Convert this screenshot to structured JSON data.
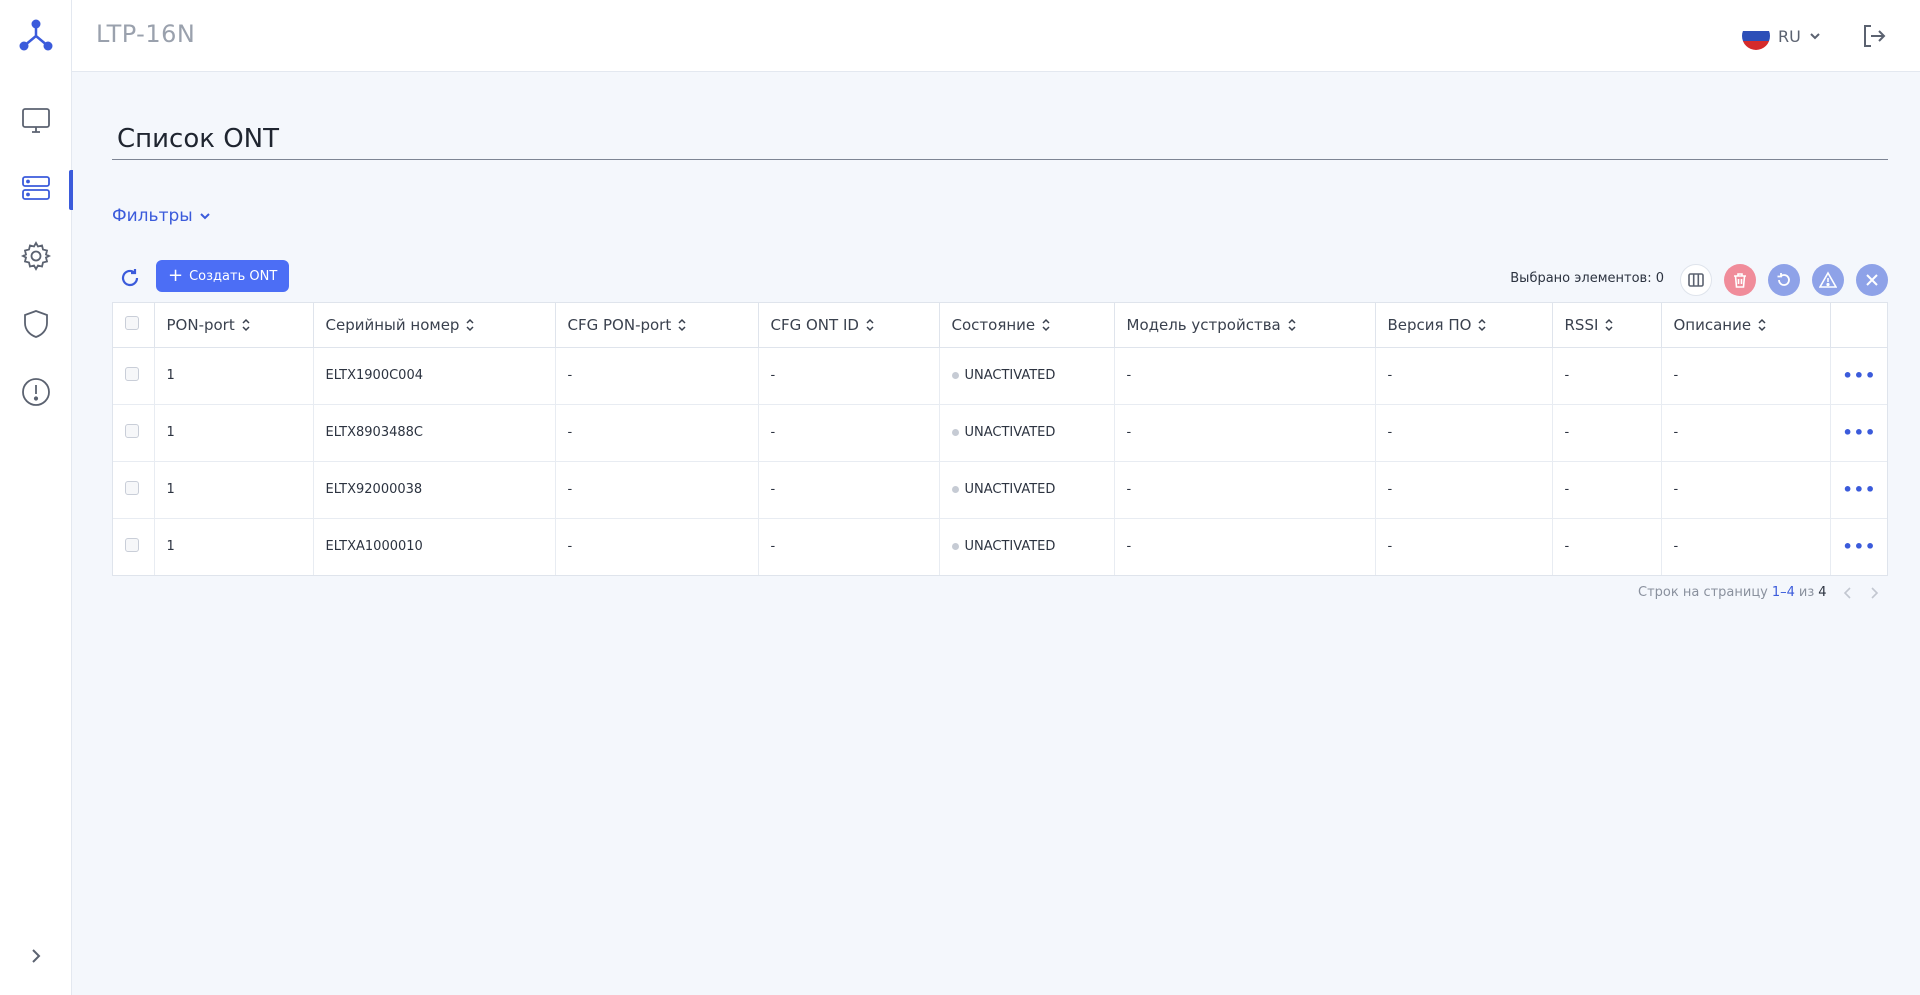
{
  "header": {
    "device_name": "LTP-16N",
    "language": "RU"
  },
  "sidebar": {
    "items": [
      {
        "name": "monitor",
        "icon": "monitor-icon"
      },
      {
        "name": "devices",
        "icon": "server-icon",
        "active": true
      },
      {
        "name": "settings",
        "icon": "gear-icon"
      },
      {
        "name": "security",
        "icon": "shield-icon"
      },
      {
        "name": "alarms",
        "icon": "alert-circle-icon"
      }
    ]
  },
  "page": {
    "title": "Список ONT",
    "filters_label": "Фильтры"
  },
  "toolbar": {
    "create_label": "Создать ONT",
    "selected_label": "Выбрано элементов: 0"
  },
  "table": {
    "columns": [
      "PON-port",
      "Серийный номер",
      "CFG PON-port",
      "CFG ONT ID",
      "Состояние",
      "Модель устройства",
      "Версия ПО",
      "RSSI",
      "Описание"
    ],
    "rows": [
      {
        "pon_port": "1",
        "serial": "ELTX1900C004",
        "cfg_pon_port": "-",
        "cfg_ont_id": "-",
        "state": "UNACTIVATED",
        "model": "-",
        "fw": "-",
        "rssi": "-",
        "description": "-"
      },
      {
        "pon_port": "1",
        "serial": "ELTX8903488C",
        "cfg_pon_port": "-",
        "cfg_ont_id": "-",
        "state": "UNACTIVATED",
        "model": "-",
        "fw": "-",
        "rssi": "-",
        "description": "-"
      },
      {
        "pon_port": "1",
        "serial": "ELTX92000038",
        "cfg_pon_port": "-",
        "cfg_ont_id": "-",
        "state": "UNACTIVATED",
        "model": "-",
        "fw": "-",
        "rssi": "-",
        "description": "-"
      },
      {
        "pon_port": "1",
        "serial": "ELTXA1000010",
        "cfg_pon_port": "-",
        "cfg_ont_id": "-",
        "state": "UNACTIVATED",
        "model": "-",
        "fw": "-",
        "rssi": "-",
        "description": "-"
      }
    ],
    "more_label": "•••"
  },
  "pagination": {
    "label": "Строк на страницу",
    "range": "1–4",
    "of": "из",
    "total": "4"
  },
  "colors": {
    "accent": "#3b5bdb",
    "button": "#4c6ef5",
    "delete": "#f08c9a",
    "status_dot": "#c6cbd4"
  }
}
